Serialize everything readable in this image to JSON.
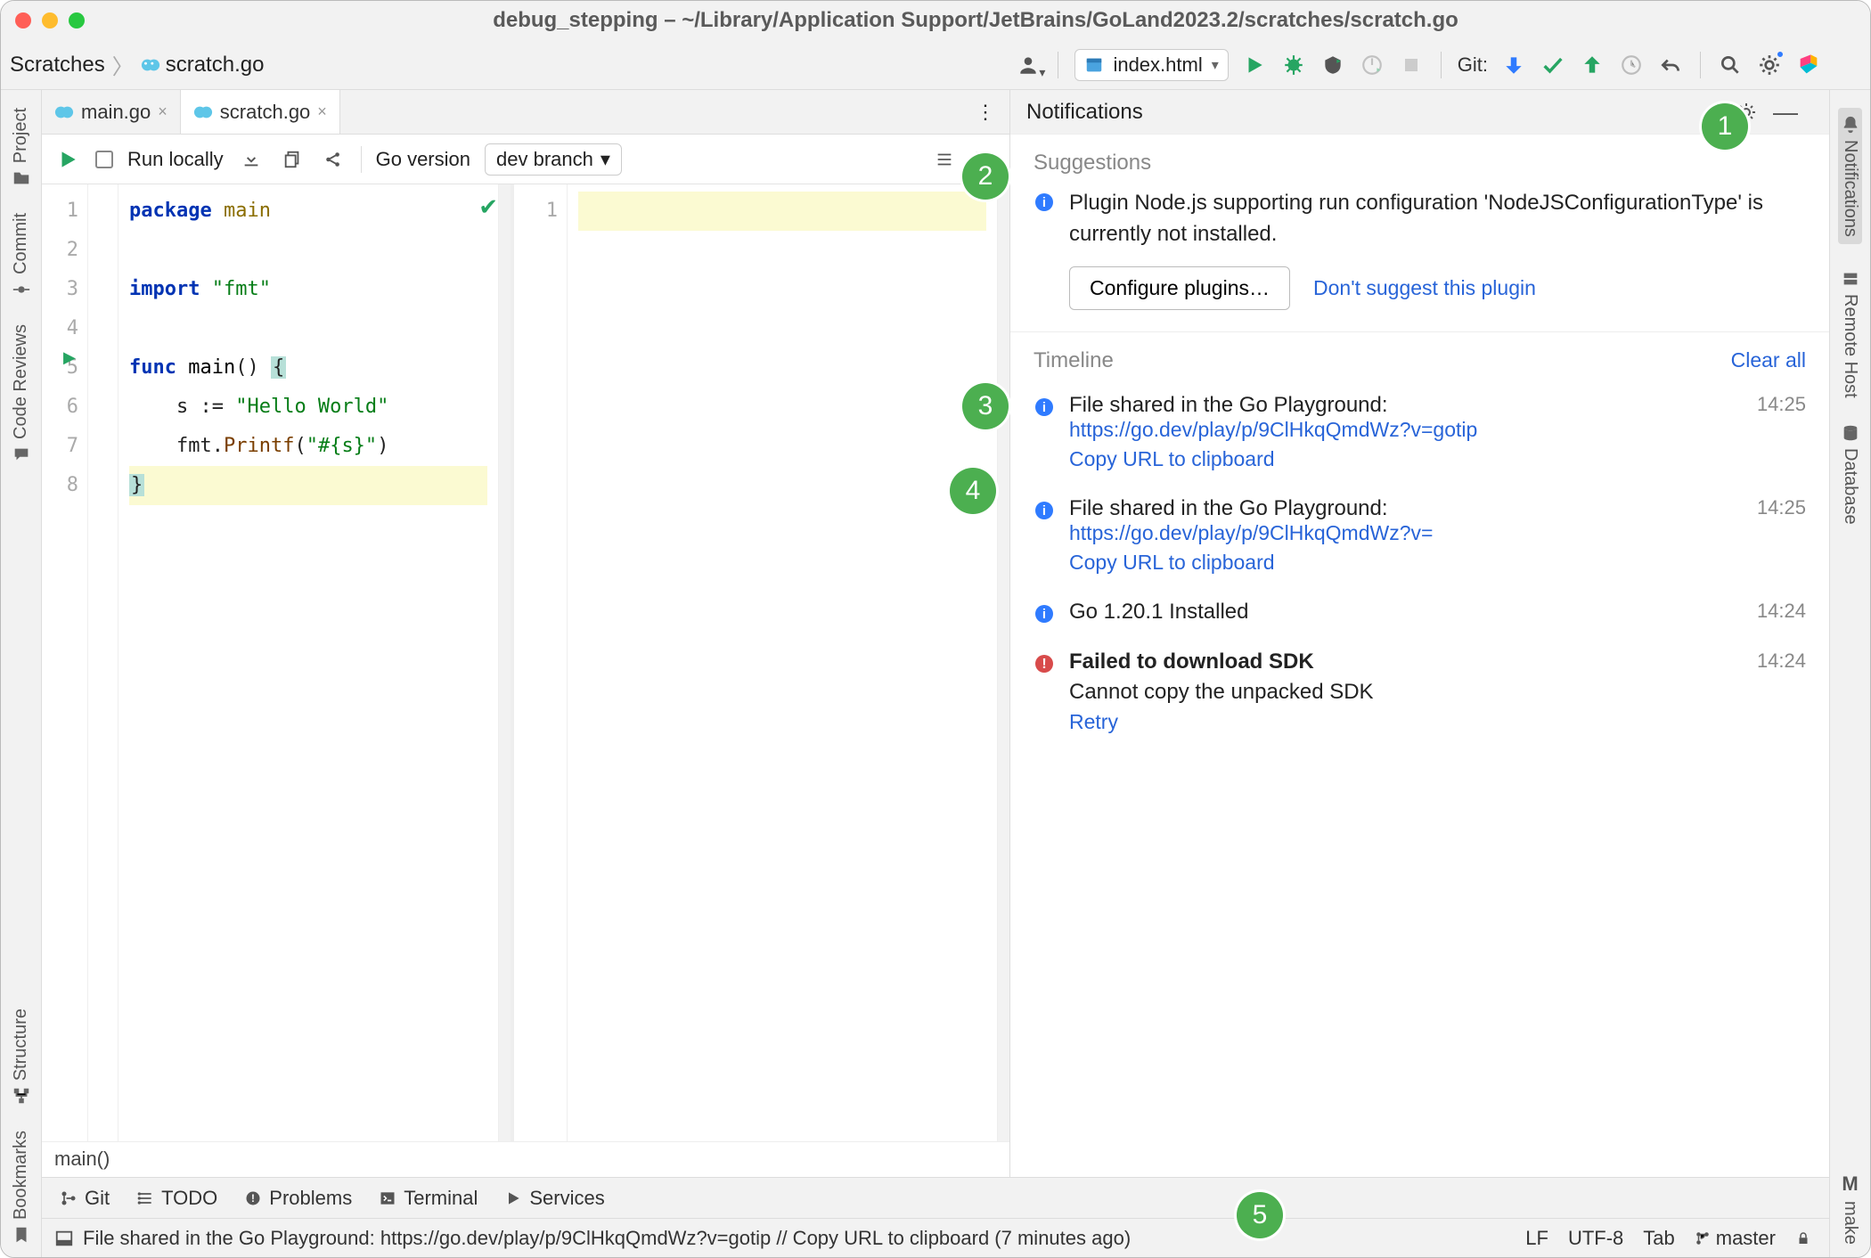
{
  "window": {
    "title": "debug_stepping – ~/Library/Application Support/JetBrains/GoLand2023.2/scratches/scratch.go"
  },
  "breadcrumbs": {
    "root": "Scratches",
    "file": "scratch.go"
  },
  "nav": {
    "run_config": "index.html",
    "git_label": "Git:"
  },
  "left_rail": [
    {
      "label": "Project"
    },
    {
      "label": "Commit"
    },
    {
      "label": "Code Reviews"
    },
    {
      "label": "Structure"
    },
    {
      "label": "Bookmarks"
    }
  ],
  "right_rail": [
    {
      "label": "Notifications"
    },
    {
      "label": "Remote Host"
    },
    {
      "label": "Database"
    },
    {
      "label": "make"
    }
  ],
  "tabs": [
    {
      "label": "main.go",
      "active": false
    },
    {
      "label": "scratch.go",
      "active": true
    }
  ],
  "editor_toolbar": {
    "run_locally": "Run locally",
    "go_version_label": "Go version",
    "go_version_value": "dev branch"
  },
  "code": {
    "lines": [
      "1",
      "2",
      "3",
      "4",
      "5",
      "6",
      "7",
      "8"
    ],
    "l1_kw": "package",
    "l1_pkg": "main",
    "l3_kw": "import",
    "l3_str": "\"fmt\"",
    "l5_kw": "func",
    "l5_name": "main",
    "l5_paren": "()",
    "l5_brace": "{",
    "l6": "    s := ",
    "l6_str": "\"Hello World\"",
    "l7a": "    fmt.",
    "l7_fn": "Printf",
    "l7b": "(",
    "l7_str": "\"#{s}\"",
    "l7c": ")",
    "l8_brace": "}"
  },
  "right_gutter_line": "1",
  "notifications": {
    "header": "Notifications",
    "suggestions_title": "Suggestions",
    "suggestion_text": "Plugin Node.js supporting run configuration 'NodeJSConfigurationType' is currently not installed.",
    "configure_btn": "Configure plugins…",
    "dont_suggest": "Don't suggest this plugin",
    "timeline_title": "Timeline",
    "clear_all": "Clear all",
    "items": [
      {
        "title": "File shared in the Go Playground:",
        "url": "https://go.dev/play/p/9ClHkqQmdWz?v=gotip",
        "action": "Copy URL to clipboard",
        "ts": "14:25",
        "kind": "info"
      },
      {
        "title": "File shared in the Go Playground:",
        "url": "https://go.dev/play/p/9ClHkqQmdWz?v=",
        "action": "Copy URL to clipboard",
        "ts": "14:25",
        "kind": "info"
      },
      {
        "title": "Go 1.20.1 Installed",
        "ts": "14:24",
        "kind": "info"
      },
      {
        "title": "Failed to download SDK",
        "sub": "Cannot copy the unpacked SDK",
        "action": "Retry",
        "ts": "14:24",
        "kind": "error"
      }
    ]
  },
  "crumb": "main()",
  "toolstrip": {
    "git": "Git",
    "todo": "TODO",
    "problems": "Problems",
    "terminal": "Terminal",
    "services": "Services"
  },
  "statusbar": {
    "msg": "File shared in the Go Playground: https://go.dev/play/p/9ClHkqQmdWz?v=gotip // Copy URL to clipboard (7 minutes ago)",
    "lf": "LF",
    "enc": "UTF-8",
    "indent": "Tab",
    "branch": "master"
  },
  "callouts": [
    "1",
    "2",
    "3",
    "4",
    "5"
  ]
}
